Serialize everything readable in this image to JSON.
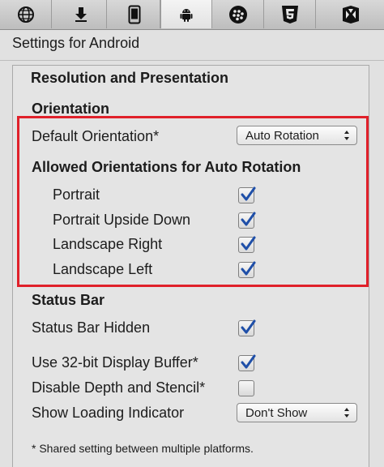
{
  "tabs": [
    {
      "icon": "globe-icon",
      "active": false
    },
    {
      "icon": "download-icon",
      "active": false
    },
    {
      "icon": "ios-device-icon",
      "active": false
    },
    {
      "icon": "android-icon",
      "active": true
    },
    {
      "icon": "blackberry-icon",
      "active": false
    },
    {
      "icon": "html5-icon",
      "active": false
    },
    {
      "icon": "flash-icon",
      "active": false
    }
  ],
  "header": {
    "title": "Settings for Android"
  },
  "section": {
    "title": "Resolution and Presentation",
    "orientation_heading": "Orientation",
    "default_orientation": {
      "label": "Default Orientation*",
      "value": "Auto Rotation"
    },
    "allowed_heading": "Allowed Orientations for Auto Rotation",
    "allowed": [
      {
        "label": "Portrait",
        "checked": true
      },
      {
        "label": "Portrait Upside Down",
        "checked": true
      },
      {
        "label": "Landscape Right",
        "checked": true
      },
      {
        "label": "Landscape Left",
        "checked": true
      }
    ],
    "status_bar_heading": "Status Bar",
    "status_bar_hidden": {
      "label": "Status Bar Hidden",
      "checked": true
    },
    "display_buffer": {
      "label": "Use 32-bit Display Buffer*",
      "checked": true
    },
    "depth_stencil": {
      "label": "Disable Depth and Stencil*",
      "checked": false
    },
    "loading_indicator": {
      "label": "Show Loading Indicator",
      "value": "Don't Show"
    },
    "footnote": "* Shared setting between multiple platforms."
  },
  "colors": {
    "highlight": "#e0202a",
    "checkmark": "#1f4fa8"
  }
}
